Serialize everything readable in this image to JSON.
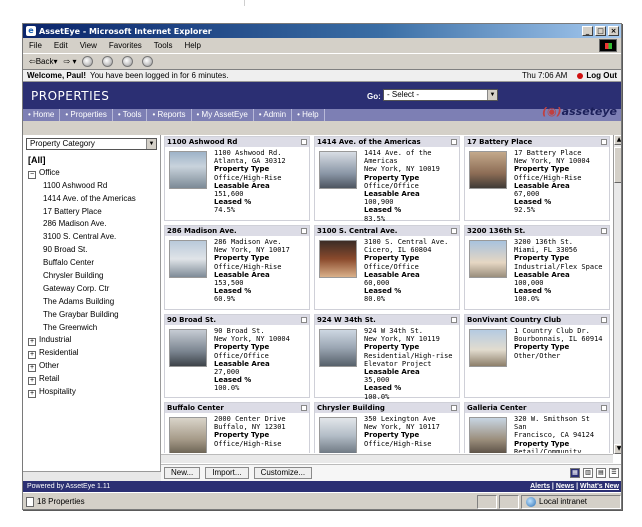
{
  "browser": {
    "title": "AssetEye - Microsoft Internet Explorer",
    "menu": [
      "File",
      "Edit",
      "View",
      "Favorites",
      "Tools",
      "Help"
    ],
    "back_label": "Back"
  },
  "welcome": {
    "name": "Welcome, Paul!",
    "message": "You have been logged in for 6 minutes.",
    "time": "Thu 7:06 AM",
    "logout": "Log Out"
  },
  "header": {
    "title": "PROPERTIES",
    "go_label": "Go:",
    "go_select": "- Select -"
  },
  "nav": {
    "items": [
      "Home",
      "Properties",
      "Tools",
      "Reports",
      "My AssetEye",
      "Admin",
      "Help"
    ],
    "brand_mark": "(◉)",
    "brand": "asseteye"
  },
  "sidebar": {
    "category_select": "Property Category",
    "all": "[All]",
    "office": "Office",
    "office_children": [
      "1100 Ashwood Rd",
      "1414 Ave. of the Americas",
      "17 Battery Place",
      "286 Madison Ave.",
      "3100 S. Central Ave.",
      "90 Broad St.",
      "Buffalo Center",
      "Chrysler Building",
      "Gateway Corp. Ctr",
      "The Adams Building",
      "The Graybar Building",
      "The Greenwich"
    ],
    "collapsed": [
      "Industrial",
      "Residential",
      "Other",
      "Retail",
      "Hospitality"
    ]
  },
  "cards": [
    {
      "name": "1100 Ashwood Rd",
      "addr1": "1100 Ashwood Rd.",
      "addr2": "Atlanta, GA  30312",
      "type": "Office/High-Rise",
      "type2": "",
      "area": "151,600",
      "leased": "74.5%"
    },
    {
      "name": "1414 Ave. of the Americas",
      "addr1": "1414 Ave. of the",
      "addr2": "Americas",
      "addr3": "New York, NY  10019",
      "type": "Office/Office",
      "type2": "",
      "area": "100,900",
      "leased": "83.5%"
    },
    {
      "name": "17 Battery Place",
      "addr1": "17 Battery Place",
      "addr2": "New York, NY  10004",
      "type": "Office/High-Rise",
      "type2": "",
      "area": "67,000",
      "leased": "92.5%"
    },
    {
      "name": "286 Madison Ave.",
      "addr1": "286 Madison Ave.",
      "addr2": "New York, NY  10017",
      "type": "Office/High-Rise",
      "type2": "",
      "area": "153,500",
      "leased": "60.9%"
    },
    {
      "name": "3100 S. Central Ave.",
      "addr1": "3100 S. Central Ave.",
      "addr2": "Cicero, IL  60804",
      "type": "Office/Office",
      "type2": "",
      "area": "60,000",
      "leased": "80.0%"
    },
    {
      "name": "3200 136th St.",
      "addr1": "3200 136th St.",
      "addr2": "Miami, FL  33056",
      "type": "Industrial/Flex Space",
      "type2": "",
      "area": "100,000",
      "leased": "100.0%"
    },
    {
      "name": "90 Broad St.",
      "addr1": "90 Broad St.",
      "addr2": "New York, NY  10004",
      "type": "Office/Office",
      "type2": "",
      "area": "27,000",
      "leased": "100.0%"
    },
    {
      "name": "924 W 34th St.",
      "addr1": "924 W 34th St.",
      "addr2": "New York, NY  10119",
      "type": "Residential/High-rise",
      "type2": "Elevator Project",
      "area": "35,000",
      "leased": "100.0%"
    },
    {
      "name": "BonVivant Country Club",
      "addr1": "1 Country Club Dr.",
      "addr2": "Bourbonnais, IL  60914",
      "type": "Other/Other",
      "type2": "",
      "area": "",
      "leased": ""
    },
    {
      "name": "Buffalo Center",
      "addr1": "2000 Center Drive",
      "addr2": "Buffalo, NY  12301",
      "type": "Office/High-Rise",
      "type2": "",
      "area": "",
      "leased": ""
    },
    {
      "name": "Chrysler Building",
      "addr1": "350 Lexington Ave",
      "addr2": "New York, NY  10117",
      "type": "Office/High-Rise",
      "type2": "",
      "area": "",
      "leased": ""
    },
    {
      "name": "Galleria Center",
      "addr1": "320 W. Smithson St",
      "addr2": "San",
      "addr3": "Francisco, CA  94124",
      "type": "Retail/Community",
      "type2": "",
      "area": "",
      "leased": ""
    }
  ],
  "labels": {
    "property_type": "Property Type",
    "leasable_area": "Leasable Area",
    "leased": "Leased %"
  },
  "buttons": {
    "new": "New...",
    "import": "Import...",
    "customize": "Customize..."
  },
  "footer": {
    "powered": "Powered by AssetEye 1.11",
    "links": [
      "Alerts",
      "News",
      "What's New"
    ]
  },
  "status": {
    "count": "18 Properties",
    "zone": "Local intranet"
  }
}
